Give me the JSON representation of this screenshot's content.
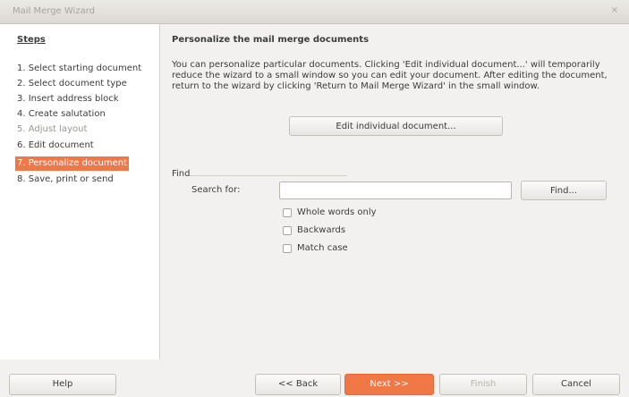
{
  "window": {
    "title": "Mail Merge Wizard",
    "close_glyph": "×"
  },
  "sidebar": {
    "header": "Steps",
    "items": [
      {
        "label": "1. Select starting document",
        "state": "normal"
      },
      {
        "label": "2. Select document type",
        "state": "normal"
      },
      {
        "label": "3. Insert address block",
        "state": "normal"
      },
      {
        "label": "4. Create salutation",
        "state": "normal"
      },
      {
        "label": "5. Adjust layout",
        "state": "disabled"
      },
      {
        "label": "6. Edit document",
        "state": "normal"
      },
      {
        "label": "7. Personalize document",
        "state": "active"
      },
      {
        "label": "8. Save, print or send",
        "state": "normal"
      }
    ]
  },
  "main": {
    "heading": "Personalize the mail merge documents",
    "description": "You can personalize particular documents. Clicking 'Edit individual document...' will temporarily reduce the wizard to a small window so you can edit your document. After editing the document, return to the wizard by clicking 'Return to Mail Merge Wizard' in the small window.",
    "edit_button": "Edit individual document...",
    "find": {
      "section_label": "Find",
      "search_label": "Search for:",
      "search_value": "",
      "find_button": "Find...",
      "options": [
        {
          "label": "Whole words only",
          "checked": false
        },
        {
          "label": "Backwards",
          "checked": false
        },
        {
          "label": "Match case",
          "checked": false
        }
      ]
    }
  },
  "footer": {
    "help": "Help",
    "back": "<< Back",
    "next": "Next >>",
    "finish": "Finish",
    "cancel": "Cancel"
  },
  "colors": {
    "accent": "#f07746",
    "disabled_text": "#9a9690"
  }
}
